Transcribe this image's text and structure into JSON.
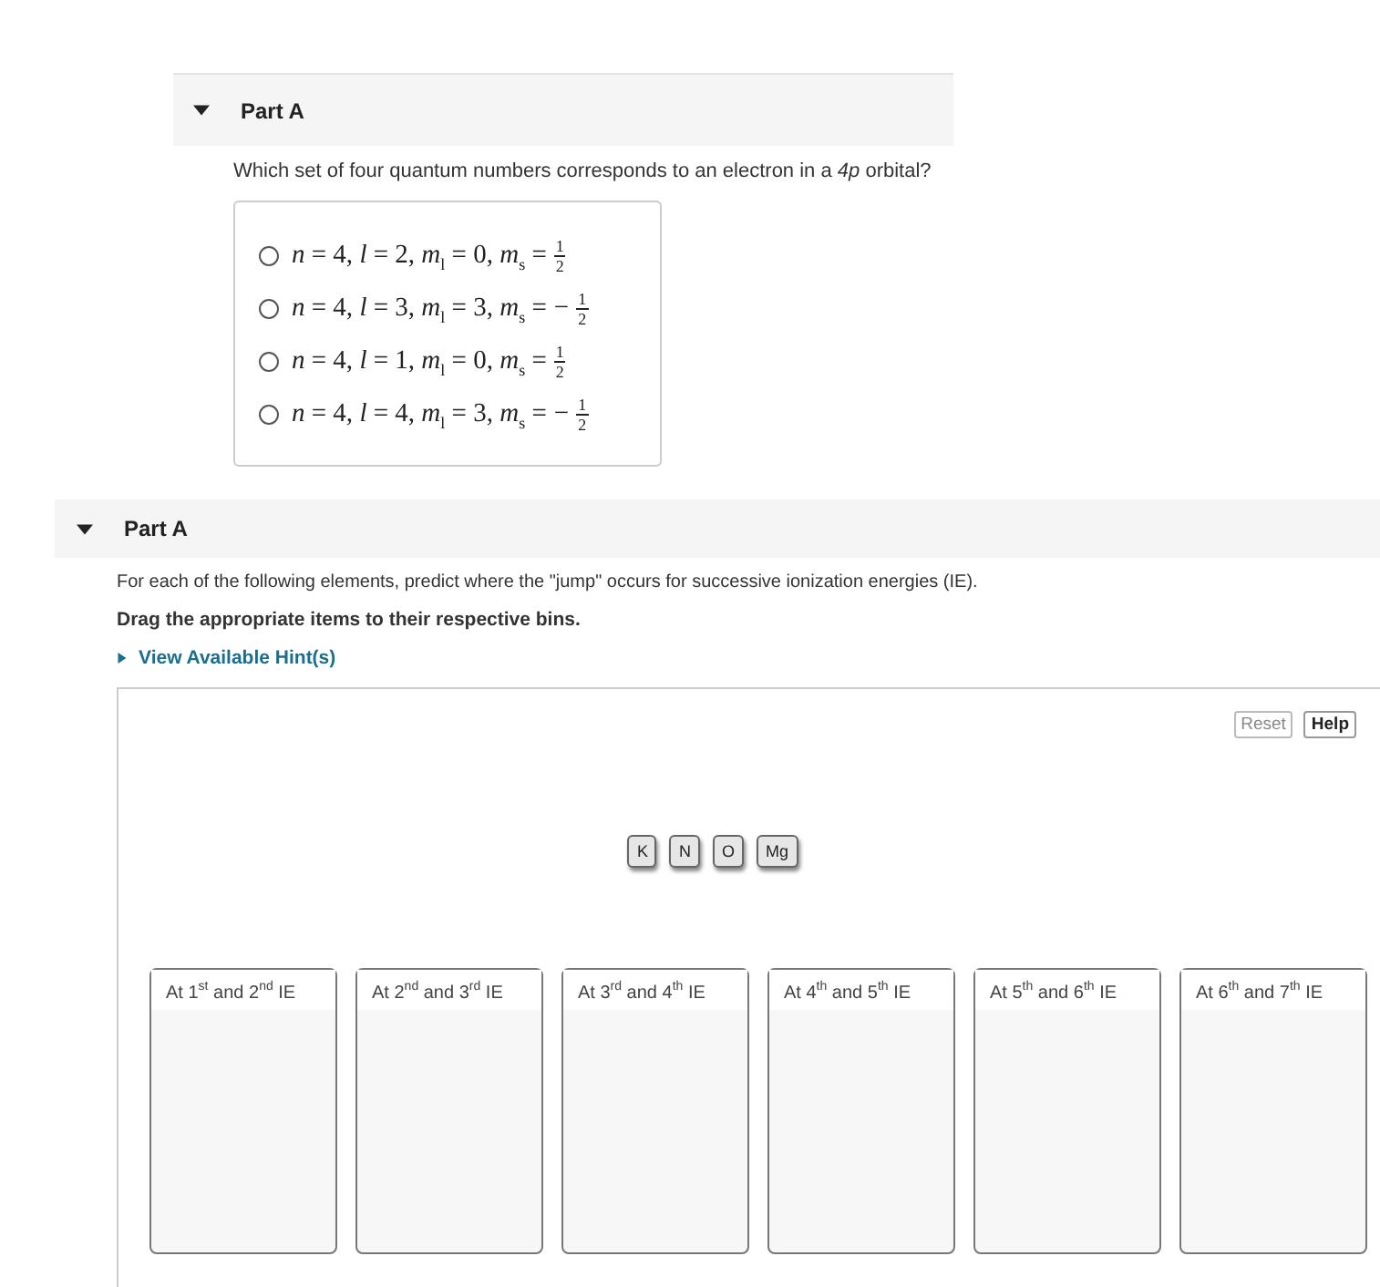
{
  "part_one": {
    "header": {
      "title": "Part A",
      "expanded": true
    },
    "question": "Which set of four quantum numbers corresponds to an electron in a *4p* orbital?",
    "options": [
      {
        "expr": "*n* = 4, *l* = 2, *m*$_{l}$ = 0, *m*$_{s}$ =",
        "numerator": "1",
        "denominator": "2",
        "selected": false
      },
      {
        "expr": "*n* = 4, *l* = 3, *m*$_{l}$ = 3, *m*$_{s}$ =",
        "sign": "−",
        "numerator": "1",
        "denominator": "2",
        "selected": false
      },
      {
        "expr": "*n* = 4, *l* = 1, *m*$_{l}$ = 0, *m*$_{s}$ =",
        "numerator": "1",
        "denominator": "2",
        "selected": false
      },
      {
        "expr": "*n* = 4, *l* = 4, *m*$_{l}$ = 3, *m*$_{s}$ =",
        "sign": "−",
        "numerator": "1",
        "denominator": "2",
        "selected": false
      }
    ]
  },
  "part_two": {
    "header": {
      "title": "Part A",
      "expanded": true
    },
    "instruction": "For each of the following elements, predict where the \"jump\" occurs for successive ionization energies (IE).",
    "directive": "Drag the appropriate items to their respective bins.",
    "hint_link": {
      "label": "View Available Hint(s)",
      "expanded": false
    },
    "buttons": [
      {
        "label": "Reset",
        "disabled": true
      },
      {
        "label": "Help",
        "disabled": false
      }
    ],
    "tiles": [
      "K",
      "N",
      "O",
      "Mg"
    ],
    "bins": [
      "At 1$^{st}$ and 2$^{nd}$ IE",
      "At 2$^{nd}$ and 3$^{rd}$ IE",
      "At 3$^{rd}$ and 4$^{th}$ IE",
      "At 4$^{th}$ and 5$^{th}$ IE",
      "At 5$^{th}$ and 6$^{th}$ IE",
      "At 6$^{th}$ and 7$^{th}$ IE"
    ]
  }
}
